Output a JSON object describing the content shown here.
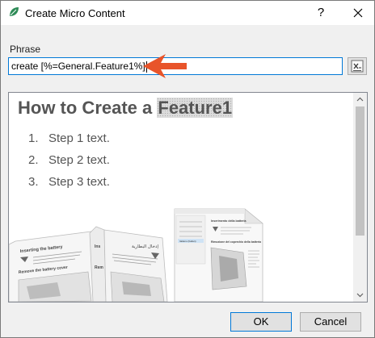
{
  "window": {
    "title": "Create Micro Content",
    "help_label": "?",
    "icon": "leaf-logo-icon",
    "close_icon": "close-icon"
  },
  "phrase": {
    "label": "Phrase",
    "value": "create [%=General.Feature1%]",
    "insert_variable_icon": "insert-variable-icon"
  },
  "preview": {
    "title_prefix": "How to Create a ",
    "title_variable": "Feature1",
    "steps": [
      {
        "number": "1.",
        "text": "Step 1 text."
      },
      {
        "number": "2.",
        "text": "Step 2 text."
      },
      {
        "number": "3.",
        "text": "Step 3 text."
      }
    ],
    "image_texts": {
      "booklet_heading": "Inserting the battery",
      "booklet_subheading": "Remove the battery cover",
      "booklet_partial_heading": "Ins",
      "booklet_partial_sub": "Rem",
      "booklet_arabic": "إدخال البطارية",
      "sidebar_item_selected": "Italiano (Italian)",
      "doc_heading": "Inserimento della batteria",
      "doc_subheading": "Rimozione del coperchio della batteria"
    },
    "image_icon": "multilingual-documents-illustration",
    "scroll_up_icon": "chevron-up-icon",
    "scroll_down_icon": "chevron-down-icon"
  },
  "buttons": {
    "ok": "OK",
    "cancel": "Cancel"
  },
  "colors": {
    "accent_border": "#0078d7",
    "callout_arrow": "#e8542a",
    "logo_green": "#2e8b57",
    "heading_gray": "#555555"
  }
}
